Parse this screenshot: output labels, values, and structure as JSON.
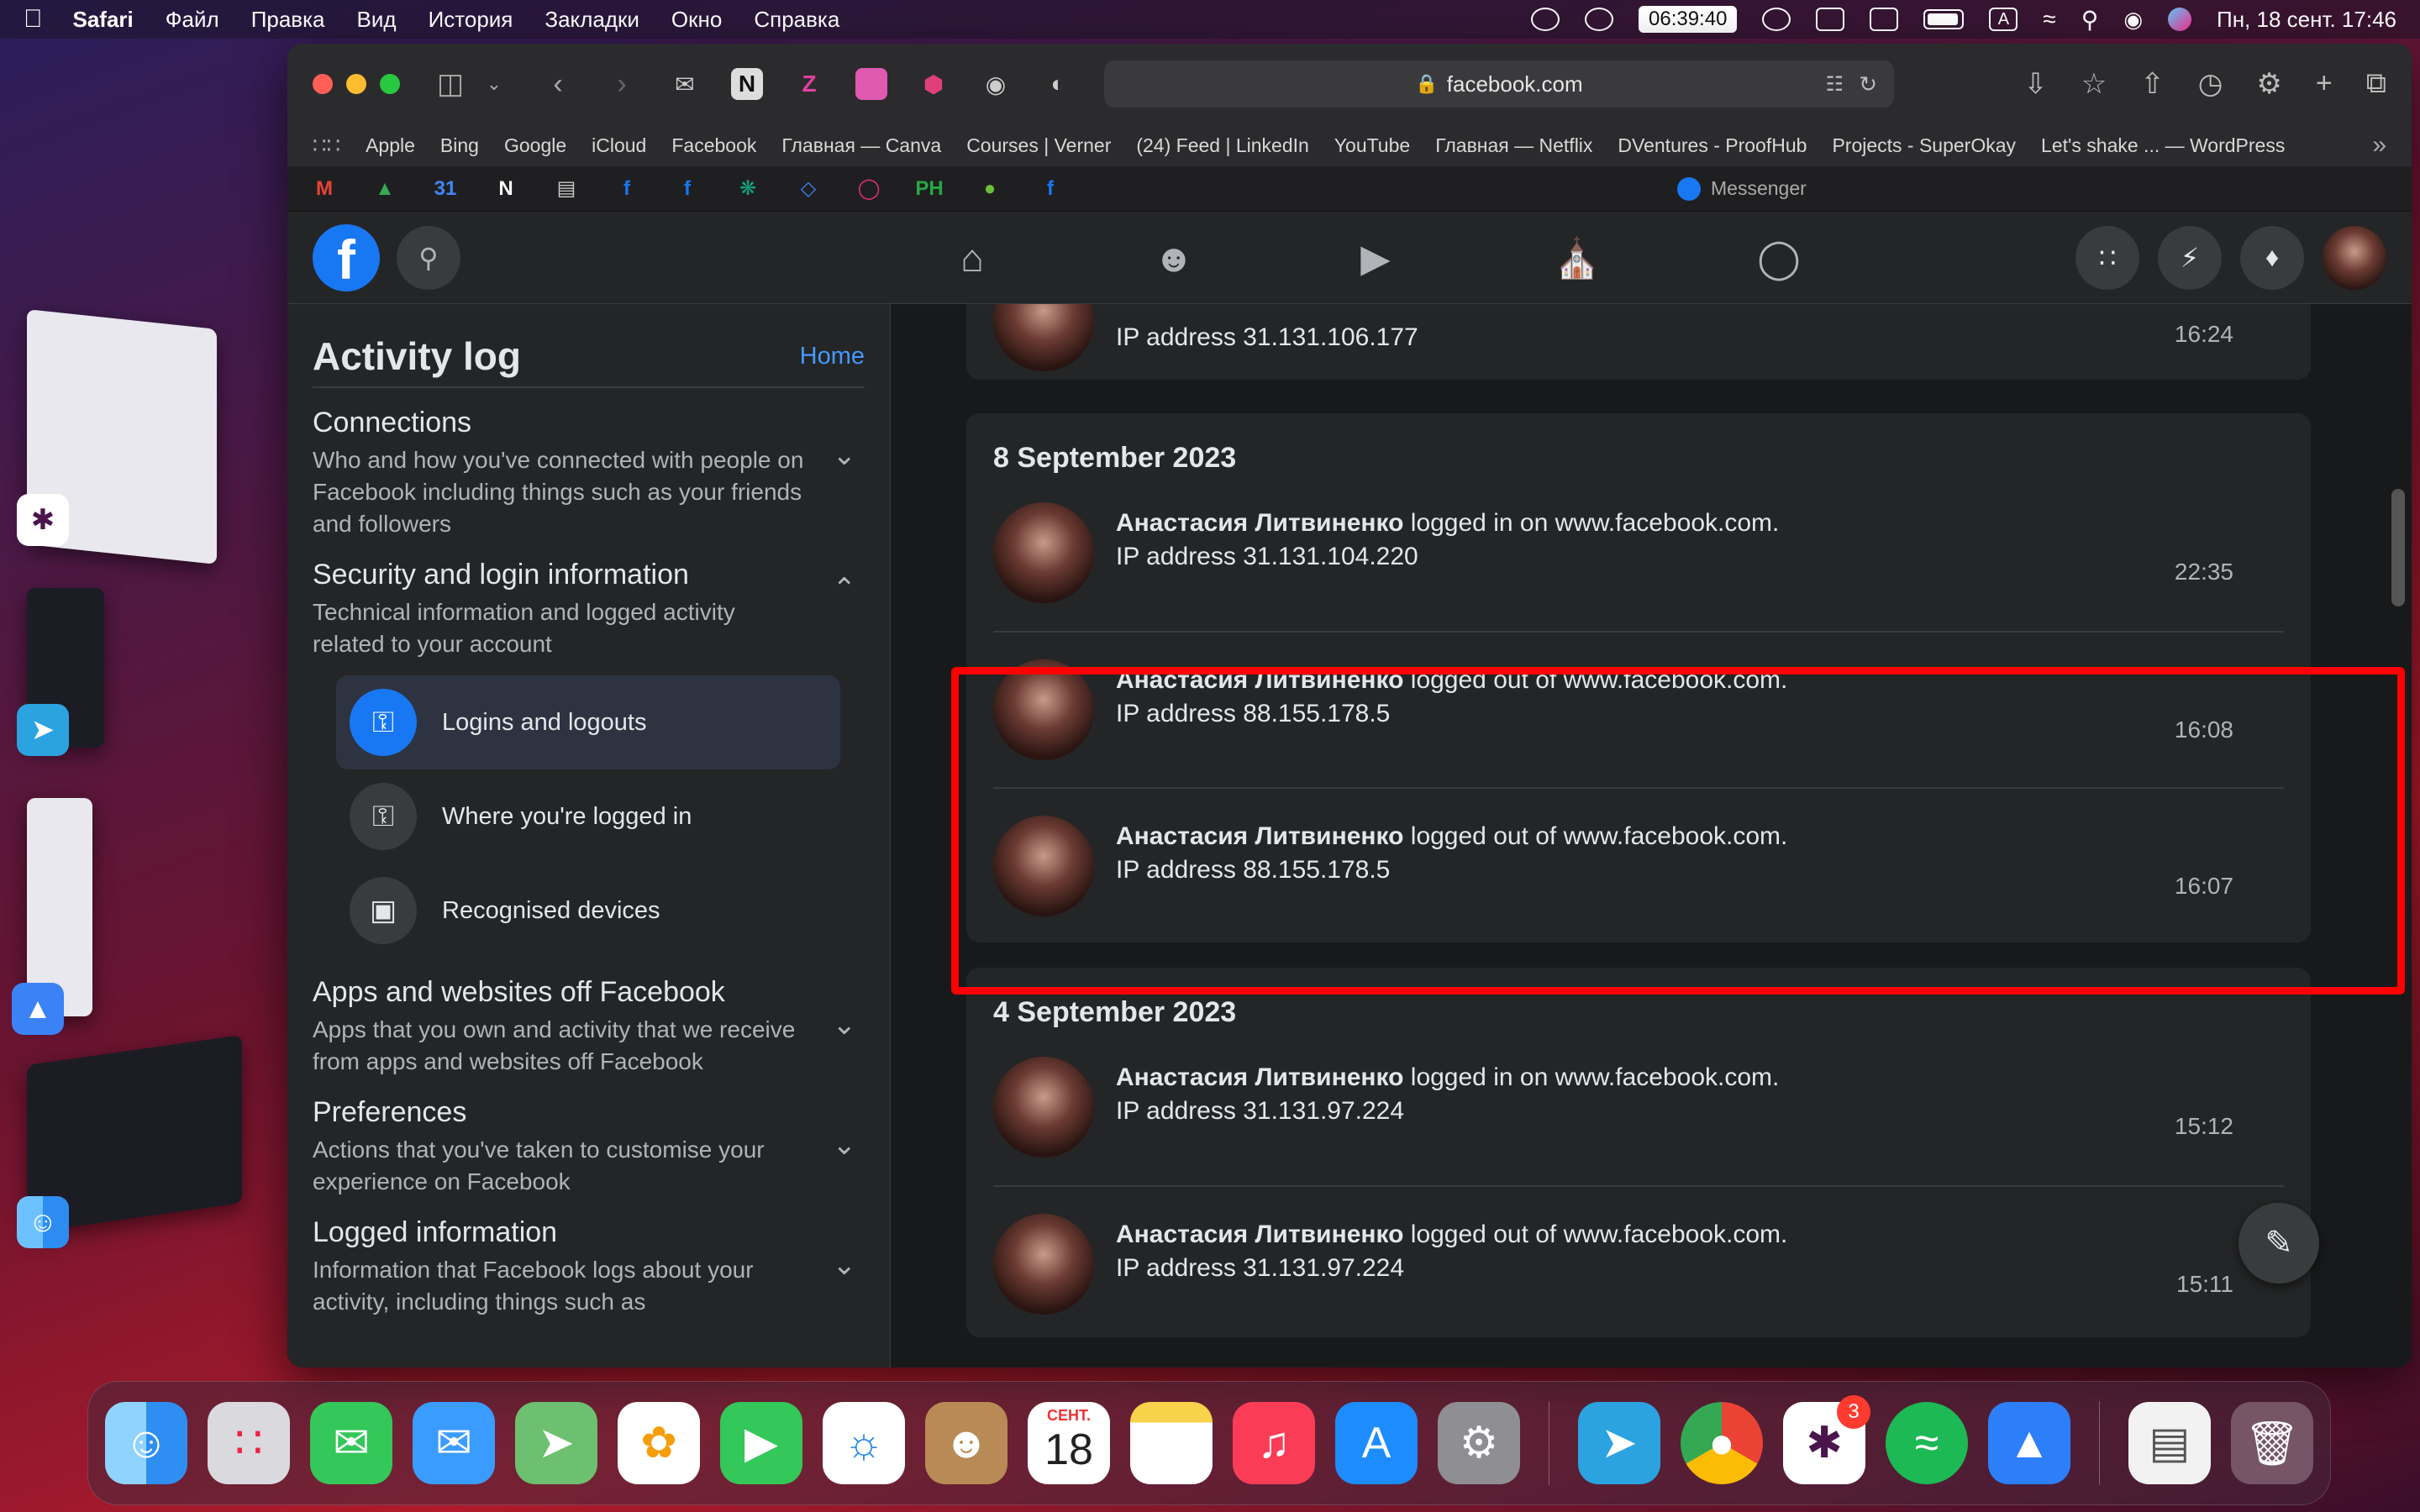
{
  "menubar": {
    "app": "Safari",
    "items": [
      "Файл",
      "Правка",
      "Вид",
      "История",
      "Закладки",
      "Окно",
      "Справка"
    ],
    "timer": "06:39:40",
    "lang": "A",
    "datetime": "Пн, 18 сент.  17:46"
  },
  "browser": {
    "url": "facebook.com",
    "bookmarks": [
      "Apple",
      "Bing",
      "Google",
      "iCloud",
      "Facebook",
      "Главная — Canva",
      "Courses | Verner",
      "(24) Feed | LinkedIn",
      "YouTube",
      "Главная — Netflix",
      "DVentures - ProofHub",
      "Projects - SuperOkay",
      "Let's shake ... — WordPress"
    ],
    "active_tab": "Messenger"
  },
  "sidebar": {
    "title": "Activity log",
    "home_link": "Home",
    "sections": [
      {
        "title": "Connections",
        "desc": "Who and how you've connected with people on Facebook including things such as your friends and followers"
      },
      {
        "title": "Security and login information",
        "desc": "Technical information and logged activity related to your account"
      },
      {
        "title": "Apps and websites off Facebook",
        "desc": "Apps that you own and activity that we receive from apps and websites off Facebook"
      },
      {
        "title": "Preferences",
        "desc": "Actions that you've taken to customise your experience on Facebook"
      },
      {
        "title": "Logged information",
        "desc": "Information that Facebook logs about your activity, including things such as"
      }
    ],
    "subitems": [
      "Logins and logouts",
      "Where you're logged in",
      "Recognised devices"
    ]
  },
  "feed": {
    "prev_entry": {
      "ip": "IP address 31.131.106.177",
      "time": "16:24"
    },
    "groups": [
      {
        "date": "8 September 2023",
        "entries": [
          {
            "name": "Анастасия Литвиненко",
            "action": " logged in on www.facebook.com.",
            "ip": "IP address 31.131.104.220",
            "time": "22:35"
          },
          {
            "name": "Анастасия Литвиненко",
            "action": " logged out of www.facebook.com.",
            "ip": "IP address 88.155.178.5",
            "time": "16:08"
          },
          {
            "name": "Анастасия Литвиненко",
            "action": " logged out of www.facebook.com.",
            "ip": "IP address 88.155.178.5",
            "time": "16:07"
          }
        ]
      },
      {
        "date": "4 September 2023",
        "entries": [
          {
            "name": "Анастасия Литвиненко",
            "action": " logged in on www.facebook.com.",
            "ip": "IP address 31.131.97.224",
            "time": "15:12"
          },
          {
            "name": "Анастасия Литвиненко",
            "action": " logged out of www.facebook.com.",
            "ip": "IP address 31.131.97.224",
            "time": "15:11"
          }
        ]
      }
    ]
  },
  "dock": {
    "calendar_month": "СЕНТ.",
    "calendar_day": "18",
    "slack_badge": "3"
  }
}
